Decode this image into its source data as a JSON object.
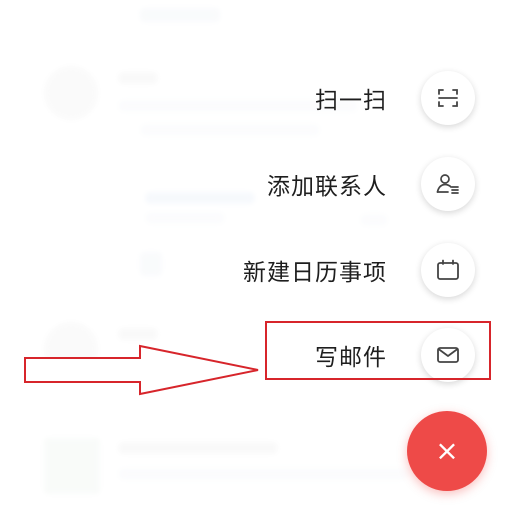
{
  "menu": {
    "scan_label": "扫一扫",
    "add_contact_label": "添加联系人",
    "new_event_label": "新建日历事项",
    "compose_mail_label": "写邮件"
  },
  "fab": {
    "icon": "close-icon",
    "glyph": "×"
  },
  "colors": {
    "fab": "#ee4a48",
    "annotation": "#d7252b",
    "menu_text": "#1e1e1e"
  },
  "icons": {
    "scan": "scan-icon",
    "add_contact": "add-contact-icon",
    "calendar": "calendar-icon",
    "mail": "mail-icon"
  }
}
